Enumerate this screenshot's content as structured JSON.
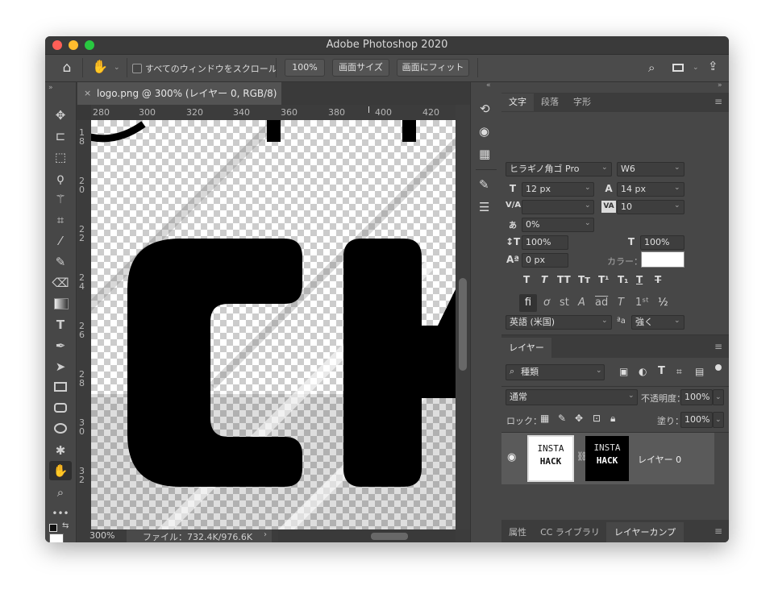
{
  "app": {
    "title": "Adobe Photoshop 2020"
  },
  "options_bar": {
    "scroll_all_label": "すべてのウィンドウをスクロール",
    "zoom_btn": "100%",
    "fit_screen_btn": "画面サイズ",
    "fill_screen_btn": "画面にフィット"
  },
  "document": {
    "tab_title": "logo.png @ 300% (レイヤー 0, RGB/8) *",
    "ruler_top": [
      "280",
      "300",
      "320",
      "340",
      "360",
      "380",
      "400",
      "420"
    ],
    "ruler_left": [
      "1\n8",
      "2\n0",
      "2\n2",
      "2\n4",
      "2\n6",
      "2\n8",
      "3\n0",
      "3\n2"
    ],
    "zoom": "300%",
    "file_info": "ファイル：732.4K/976.6K"
  },
  "character_panel": {
    "tabs": [
      "文字",
      "段落",
      "字形"
    ],
    "font_family": "ヒラギノ角ゴ Pro",
    "font_weight": "W6",
    "font_size": "12 px",
    "leading": "14 px",
    "kerning": "",
    "tracking": "10",
    "tsume": "0%",
    "vertical_scale": "100%",
    "horizontal_scale": "100%",
    "baseline_shift": "0 px",
    "color_label": "カラー：",
    "color_value": "#ffffff",
    "language": "英語 (米国)",
    "antialias": "強く"
  },
  "layers_panel": {
    "tab": "レイヤー",
    "filter_kind": "種類",
    "blend_mode": "通常",
    "opacity_label": "不透明度：",
    "opacity": "100%",
    "lock_label": "ロック：",
    "fill_label": "塗り：",
    "fill": "100%",
    "layer_name": "レイヤー 0",
    "thumb_text_1": "INSTA",
    "thumb_text_2": "HACK"
  },
  "bottom_tabs": [
    "属性",
    "CC ライブラリ",
    "レイヤーカンプ"
  ],
  "colors": {
    "accent_red": "#ff5f57",
    "accent_yellow": "#febc2e",
    "accent_green": "#28c840"
  }
}
